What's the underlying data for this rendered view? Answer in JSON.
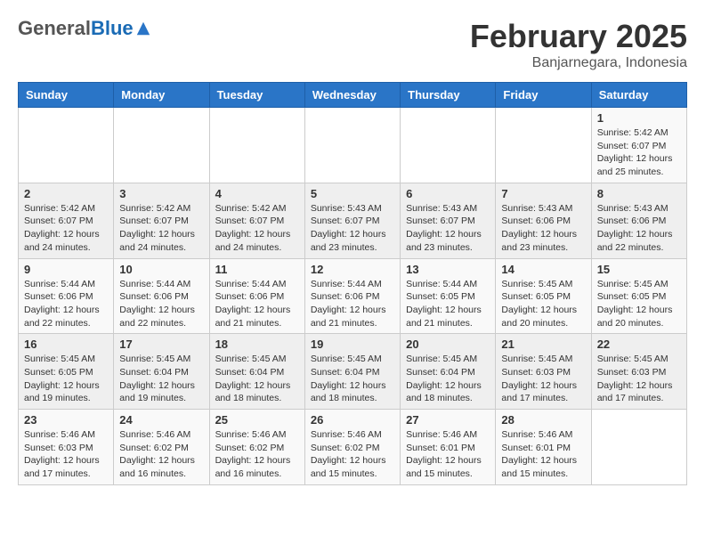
{
  "logo": {
    "general": "General",
    "blue": "Blue"
  },
  "header": {
    "month": "February 2025",
    "location": "Banjarnegara, Indonesia"
  },
  "weekdays": [
    "Sunday",
    "Monday",
    "Tuesday",
    "Wednesday",
    "Thursday",
    "Friday",
    "Saturday"
  ],
  "weeks": [
    [
      {
        "day": "",
        "info": ""
      },
      {
        "day": "",
        "info": ""
      },
      {
        "day": "",
        "info": ""
      },
      {
        "day": "",
        "info": ""
      },
      {
        "day": "",
        "info": ""
      },
      {
        "day": "",
        "info": ""
      },
      {
        "day": "1",
        "info": "Sunrise: 5:42 AM\nSunset: 6:07 PM\nDaylight: 12 hours\nand 25 minutes."
      }
    ],
    [
      {
        "day": "2",
        "info": "Sunrise: 5:42 AM\nSunset: 6:07 PM\nDaylight: 12 hours\nand 24 minutes."
      },
      {
        "day": "3",
        "info": "Sunrise: 5:42 AM\nSunset: 6:07 PM\nDaylight: 12 hours\nand 24 minutes."
      },
      {
        "day": "4",
        "info": "Sunrise: 5:42 AM\nSunset: 6:07 PM\nDaylight: 12 hours\nand 24 minutes."
      },
      {
        "day": "5",
        "info": "Sunrise: 5:43 AM\nSunset: 6:07 PM\nDaylight: 12 hours\nand 23 minutes."
      },
      {
        "day": "6",
        "info": "Sunrise: 5:43 AM\nSunset: 6:07 PM\nDaylight: 12 hours\nand 23 minutes."
      },
      {
        "day": "7",
        "info": "Sunrise: 5:43 AM\nSunset: 6:06 PM\nDaylight: 12 hours\nand 23 minutes."
      },
      {
        "day": "8",
        "info": "Sunrise: 5:43 AM\nSunset: 6:06 PM\nDaylight: 12 hours\nand 22 minutes."
      }
    ],
    [
      {
        "day": "9",
        "info": "Sunrise: 5:44 AM\nSunset: 6:06 PM\nDaylight: 12 hours\nand 22 minutes."
      },
      {
        "day": "10",
        "info": "Sunrise: 5:44 AM\nSunset: 6:06 PM\nDaylight: 12 hours\nand 22 minutes."
      },
      {
        "day": "11",
        "info": "Sunrise: 5:44 AM\nSunset: 6:06 PM\nDaylight: 12 hours\nand 21 minutes."
      },
      {
        "day": "12",
        "info": "Sunrise: 5:44 AM\nSunset: 6:06 PM\nDaylight: 12 hours\nand 21 minutes."
      },
      {
        "day": "13",
        "info": "Sunrise: 5:44 AM\nSunset: 6:05 PM\nDaylight: 12 hours\nand 21 minutes."
      },
      {
        "day": "14",
        "info": "Sunrise: 5:45 AM\nSunset: 6:05 PM\nDaylight: 12 hours\nand 20 minutes."
      },
      {
        "day": "15",
        "info": "Sunrise: 5:45 AM\nSunset: 6:05 PM\nDaylight: 12 hours\nand 20 minutes."
      }
    ],
    [
      {
        "day": "16",
        "info": "Sunrise: 5:45 AM\nSunset: 6:05 PM\nDaylight: 12 hours\nand 19 minutes."
      },
      {
        "day": "17",
        "info": "Sunrise: 5:45 AM\nSunset: 6:04 PM\nDaylight: 12 hours\nand 19 minutes."
      },
      {
        "day": "18",
        "info": "Sunrise: 5:45 AM\nSunset: 6:04 PM\nDaylight: 12 hours\nand 18 minutes."
      },
      {
        "day": "19",
        "info": "Sunrise: 5:45 AM\nSunset: 6:04 PM\nDaylight: 12 hours\nand 18 minutes."
      },
      {
        "day": "20",
        "info": "Sunrise: 5:45 AM\nSunset: 6:04 PM\nDaylight: 12 hours\nand 18 minutes."
      },
      {
        "day": "21",
        "info": "Sunrise: 5:45 AM\nSunset: 6:03 PM\nDaylight: 12 hours\nand 17 minutes."
      },
      {
        "day": "22",
        "info": "Sunrise: 5:45 AM\nSunset: 6:03 PM\nDaylight: 12 hours\nand 17 minutes."
      }
    ],
    [
      {
        "day": "23",
        "info": "Sunrise: 5:46 AM\nSunset: 6:03 PM\nDaylight: 12 hours\nand 17 minutes."
      },
      {
        "day": "24",
        "info": "Sunrise: 5:46 AM\nSunset: 6:02 PM\nDaylight: 12 hours\nand 16 minutes."
      },
      {
        "day": "25",
        "info": "Sunrise: 5:46 AM\nSunset: 6:02 PM\nDaylight: 12 hours\nand 16 minutes."
      },
      {
        "day": "26",
        "info": "Sunrise: 5:46 AM\nSunset: 6:02 PM\nDaylight: 12 hours\nand 15 minutes."
      },
      {
        "day": "27",
        "info": "Sunrise: 5:46 AM\nSunset: 6:01 PM\nDaylight: 12 hours\nand 15 minutes."
      },
      {
        "day": "28",
        "info": "Sunrise: 5:46 AM\nSunset: 6:01 PM\nDaylight: 12 hours\nand 15 minutes."
      },
      {
        "day": "",
        "info": ""
      }
    ]
  ]
}
